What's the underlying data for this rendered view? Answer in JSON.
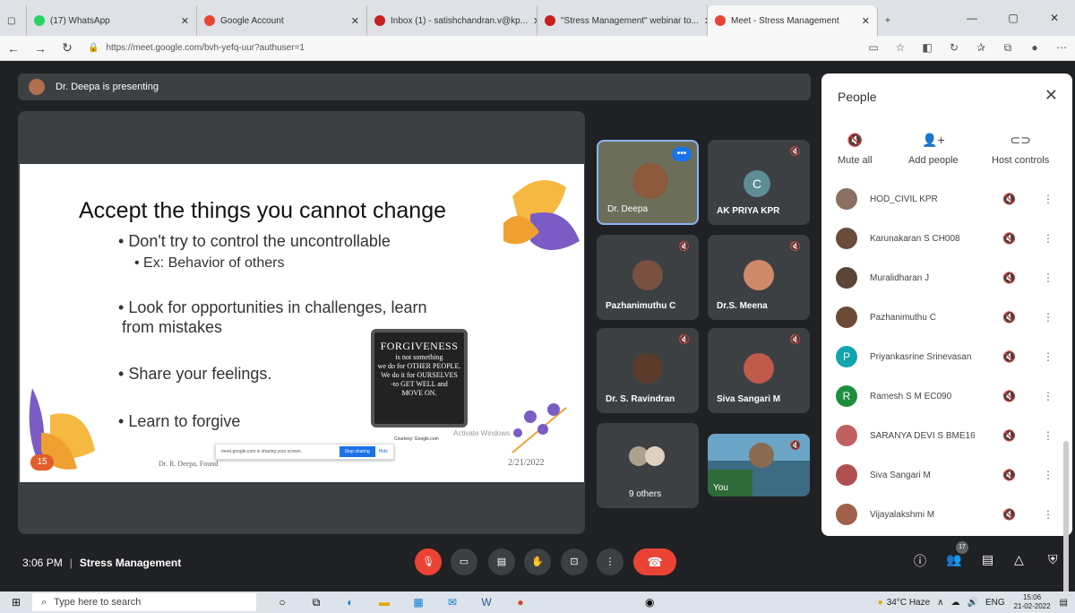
{
  "tabs": [
    {
      "title": "(17) WhatsApp",
      "color": "#25d366"
    },
    {
      "title": "Google Account",
      "color": "#ea4335"
    },
    {
      "title": "Inbox (1) - satishchandran.v@kp...",
      "color": "#c5221f"
    },
    {
      "title": "\"Stress Management\" webinar to...",
      "color": "#c5221f"
    },
    {
      "title": "Meet - Stress Management",
      "color": "#ea4335"
    }
  ],
  "url": "https://meet.google.com/bvh-yefq-uur?authuser=1",
  "presenting": "Dr. Deepa is presenting",
  "slide": {
    "title": "Accept the things you cannot change",
    "bullets": [
      "Don't try to control the uncontrollable",
      "Ex: Behavior of others",
      "Look for opportunities in challenges, learn",
      "from mistakes",
      "Share your feelings.",
      "Learn to forgive"
    ],
    "forgive_title": "FORGIVENESS",
    "forgive_lines": [
      "is not something",
      "we do for OTHER PEOPLE.",
      "We do it for OURSELVES",
      "-to GET WELL and",
      "MOVE ON."
    ],
    "courtesy": "Courtesy: Google.com",
    "watermark": "Activate Windows",
    "number": "15",
    "date": "2/21/2022",
    "author": "Dr. R. Deepa, Found",
    "share_text": "meet.google.com is sharing your screen.",
    "stop_sharing": "Stop sharing",
    "hide": "Hide"
  },
  "tiles": [
    {
      "name": "Dr. Deepa",
      "initial": ""
    },
    {
      "name": "AK PRIYA KPR",
      "initial": "C"
    },
    {
      "name": "Pazhanimuthu C",
      "initial": ""
    },
    {
      "name": "Dr.S. Meena",
      "initial": ""
    },
    {
      "name": "Dr. S. Ravindran",
      "initial": ""
    },
    {
      "name": "Siva Sangari M",
      "initial": ""
    },
    {
      "name": "9 others",
      "initial": ""
    },
    {
      "name": "You",
      "initial": ""
    }
  ],
  "people": {
    "title": "People",
    "actions": [
      "Mute all",
      "Add people",
      "Host controls"
    ],
    "list": [
      {
        "name": "HOD_CIVIL KPR",
        "initial": "",
        "color": "#8a7060"
      },
      {
        "name": "Karunakaran S CH008",
        "initial": "",
        "color": "#6b4c3a"
      },
      {
        "name": "Muralidharan J",
        "initial": "",
        "color": "#5a4636"
      },
      {
        "name": "Pazhanimuthu C",
        "initial": "",
        "color": "#6d4a35"
      },
      {
        "name": "Priyankasrine Srinevasan",
        "initial": "P",
        "color": "#12a4af"
      },
      {
        "name": "Ramesh S M EC090",
        "initial": "R",
        "color": "#1e8e3e"
      },
      {
        "name": "SARANYA DEVI S BME16",
        "initial": "",
        "color": "#c06060"
      },
      {
        "name": "Siva Sangari M",
        "initial": "",
        "color": "#b05050"
      },
      {
        "name": "Vijayalakshmi M",
        "initial": "",
        "color": "#a0604a"
      }
    ]
  },
  "meeting": {
    "time": "3:06 PM",
    "name": "Stress Management",
    "participants": "17"
  },
  "taskbar": {
    "search": "Type here to search",
    "weather": "34°C Haze",
    "lang": "ENG",
    "time": "15:06",
    "date": "21-02-2022"
  }
}
